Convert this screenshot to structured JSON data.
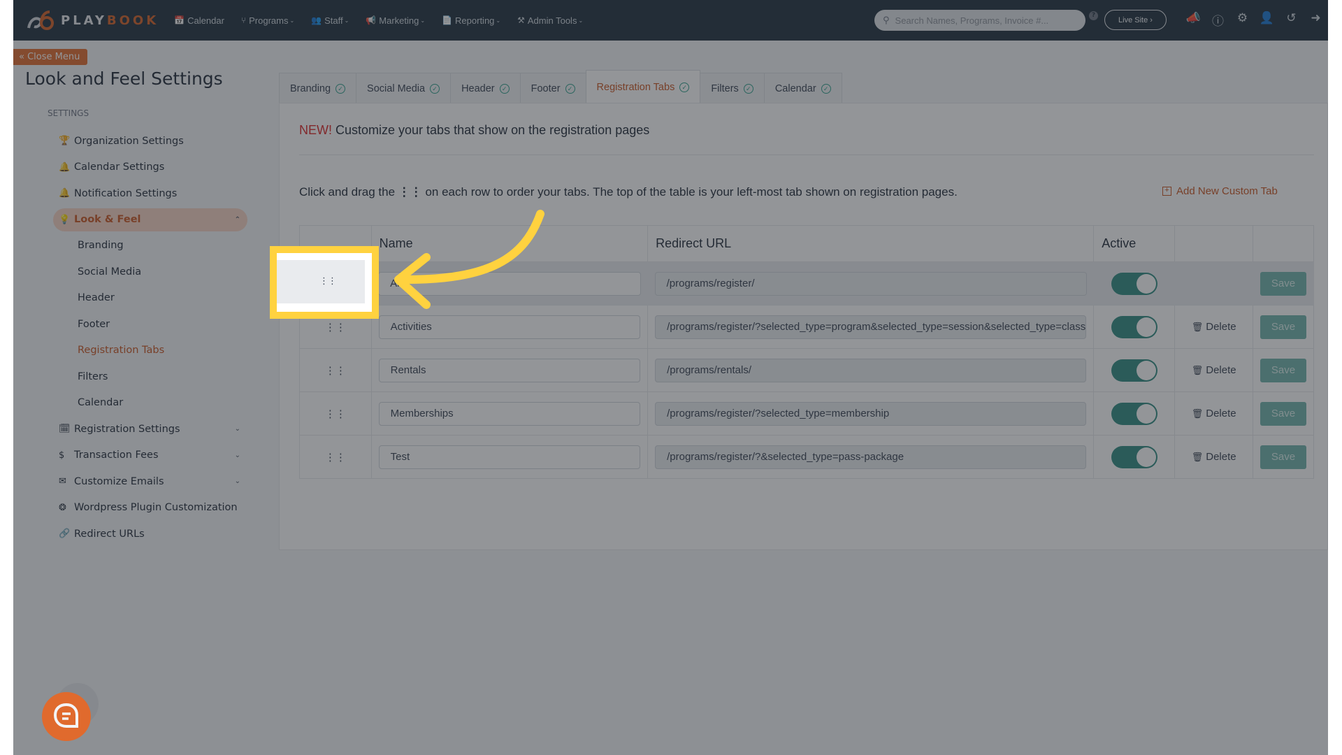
{
  "app": {
    "brand_play": "PLAY",
    "brand_book": "BOOK"
  },
  "topnav": {
    "items": [
      {
        "label": "Calendar",
        "icon": "calendar-icon",
        "has_caret": false
      },
      {
        "label": "Programs",
        "icon": "branch-icon",
        "has_caret": true
      },
      {
        "label": "Staff",
        "icon": "users-icon",
        "has_caret": true
      },
      {
        "label": "Marketing",
        "icon": "megaphone-icon",
        "has_caret": true
      },
      {
        "label": "Reporting",
        "icon": "document-icon",
        "has_caret": true
      },
      {
        "label": "Admin Tools",
        "icon": "tools-icon",
        "has_caret": true
      }
    ],
    "search_placeholder": "Search Names, Programs, Invoice #...",
    "help_mark": "?",
    "live_site_label": "Live Site ›",
    "right_icons": [
      "announcement-icon",
      "help-icon",
      "gear-icon",
      "add-user-icon",
      "history-icon",
      "logout-icon"
    ]
  },
  "sidebar": {
    "close_menu_label": "« Close Menu",
    "title": "Look and Feel Settings",
    "section_label": "SETTINGS",
    "items": [
      {
        "label": "Organization Settings",
        "icon": "trophy-icon"
      },
      {
        "label": "Calendar Settings",
        "icon": "bell-icon"
      },
      {
        "label": "Notification Settings",
        "icon": "bell-icon"
      },
      {
        "label": "Look & Feel",
        "icon": "lightbulb-icon",
        "active": true,
        "expanded": true
      },
      {
        "label": "Branding",
        "sub": true
      },
      {
        "label": "Social Media",
        "sub": true
      },
      {
        "label": "Header",
        "sub": true
      },
      {
        "label": "Footer",
        "sub": true
      },
      {
        "label": "Registration Tabs",
        "sub": true,
        "current": true
      },
      {
        "label": "Filters",
        "sub": true
      },
      {
        "label": "Calendar",
        "sub": true
      },
      {
        "label": "Registration Settings",
        "icon": "calendar-alt-icon",
        "expandable": true
      },
      {
        "label": "Transaction Fees",
        "icon": "dollar-icon",
        "expandable": true
      },
      {
        "label": "Customize Emails",
        "icon": "envelope-icon",
        "expandable": true
      },
      {
        "label": "Wordpress Plugin Customization",
        "icon": "wordpress-icon"
      },
      {
        "label": "Redirect URLs",
        "icon": "link-icon"
      }
    ]
  },
  "tabs": [
    {
      "label": "Branding",
      "complete": true
    },
    {
      "label": "Social Media",
      "complete": true
    },
    {
      "label": "Header",
      "complete": true
    },
    {
      "label": "Footer",
      "complete": true
    },
    {
      "label": "Registration Tabs",
      "complete": true,
      "active": true
    },
    {
      "label": "Filters",
      "complete": true
    },
    {
      "label": "Calendar",
      "complete": true
    }
  ],
  "content": {
    "new_badge": "NEW!",
    "headline": " Customize your tabs that show on the registration pages",
    "instruction_before": "Click and drag the ",
    "instruction_after": " on each row to order your tabs. The top of the table is your left-most tab shown on registration pages.",
    "add_tab_label": "Add New Custom Tab",
    "table": {
      "headers": [
        "",
        "Name",
        "Redirect URL",
        "Active",
        "",
        ""
      ],
      "rows": [
        {
          "name": "All",
          "url": "/programs/register/",
          "active": true,
          "deletable": false
        },
        {
          "name": "Activities",
          "url": "/programs/register/?selected_type=program&selected_type=session&selected_type=class",
          "active": true,
          "deletable": true
        },
        {
          "name": "Rentals",
          "url": "/programs/rentals/",
          "active": true,
          "deletable": true
        },
        {
          "name": "Memberships",
          "url": "/programs/register/?selected_type=membership",
          "active": true,
          "deletable": true
        },
        {
          "name": "Test",
          "url": "/programs/register/?&selected_type=pass-package",
          "active": true,
          "deletable": true
        }
      ],
      "delete_label": "Delete",
      "save_label": "Save"
    }
  },
  "colors": {
    "nav_bg": "#1e2f3d",
    "accent": "#c85420",
    "toggle_on": "#2e8b80",
    "save_bg": "#6fb3ab",
    "highlight": "#ffd23f"
  }
}
